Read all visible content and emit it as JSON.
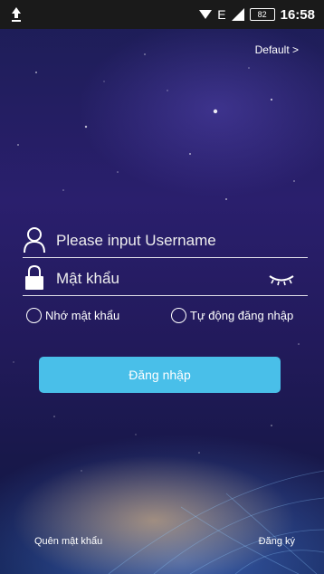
{
  "status_bar": {
    "network": "E",
    "battery": "82",
    "time": "16:58",
    "icons": [
      "upload-icon",
      "wifi-icon",
      "signal-icon",
      "battery-icon"
    ]
  },
  "header": {
    "default_label": "Default  >"
  },
  "login": {
    "username_placeholder": "Please input Username",
    "password_placeholder": "Mật khẩu",
    "remember_label": "Nhớ mật khẩu",
    "auto_login_label": "Tự động đăng nhập",
    "login_button": "Đăng nhập"
  },
  "footer": {
    "forgot_password": "Quên mật khẩu",
    "register": "Đăng ký"
  },
  "colors": {
    "accent_button": "#49bfe9",
    "background_top": "#1c1d55",
    "status_bar": "#1a1a1a"
  }
}
